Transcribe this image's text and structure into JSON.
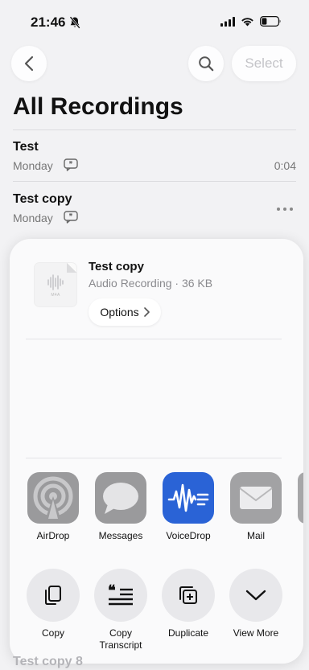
{
  "status_bar": {
    "time": "21:46"
  },
  "nav": {
    "select_label": "Select"
  },
  "page": {
    "title": "All Recordings"
  },
  "recordings": [
    {
      "title": "Test",
      "date": "Monday",
      "duration": "0:04"
    },
    {
      "title": "Test copy",
      "date": "Monday"
    }
  ],
  "background": {
    "peek_text": "Test copy 8"
  },
  "share_sheet": {
    "file_name": "Test copy",
    "file_meta": "Audio Recording · 36 KB",
    "file_ext": "M4A",
    "options_label": "Options",
    "apps": [
      {
        "label": "AirDrop",
        "icon": "airdrop-icon"
      },
      {
        "label": "Messages",
        "icon": "messages-icon"
      },
      {
        "label": "VoiceDrop",
        "icon": "voicedrop-icon"
      },
      {
        "label": "Mail",
        "icon": "mail-icon"
      }
    ],
    "actions": [
      {
        "label": "Copy",
        "icon": "copy-icon"
      },
      {
        "label": "Copy\nTranscript",
        "icon": "copy-transcript-icon"
      },
      {
        "label": "Duplicate",
        "icon": "duplicate-icon"
      },
      {
        "label": "View More",
        "icon": "chevron-down-icon"
      }
    ]
  },
  "colors": {
    "voicedrop_bg": "#2a63d6",
    "messages_bg": "#9a9a9c",
    "airdrop_bg": "#9a9a9c",
    "mail_bg": "#a2a2a4"
  }
}
